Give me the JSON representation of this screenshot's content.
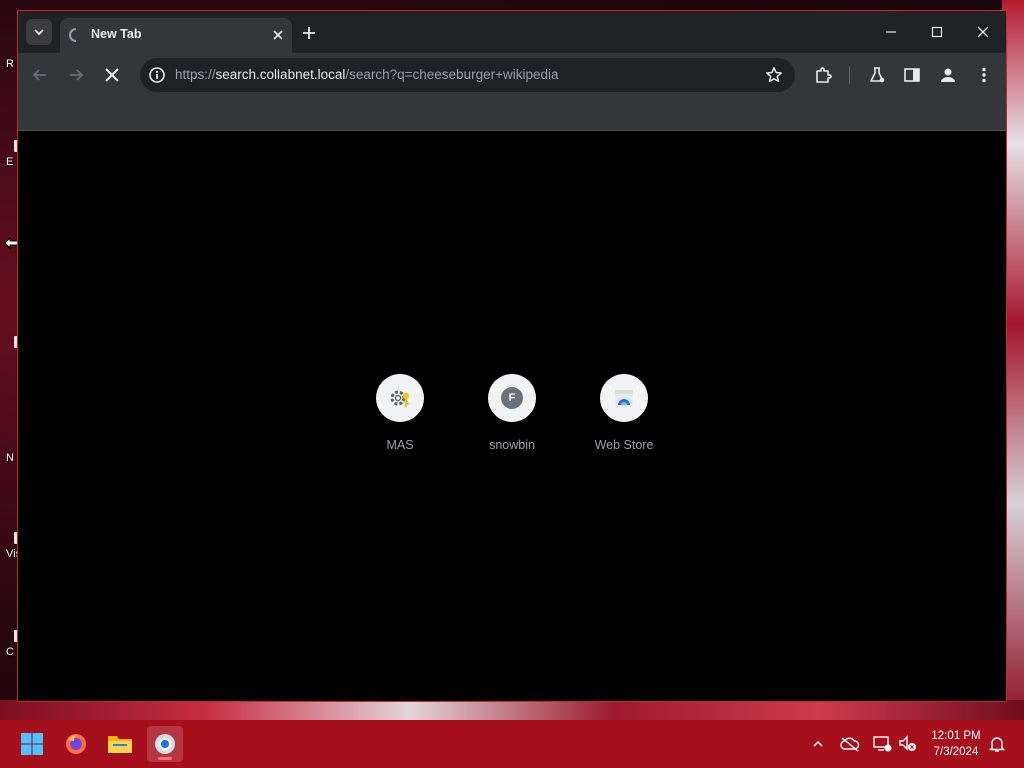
{
  "desktop": {
    "labels": [
      "R",
      "E",
      "N",
      "Vis",
      "C"
    ]
  },
  "browser": {
    "tab": {
      "title": "New Tab"
    },
    "omnibox": {
      "url_scheme": "https://",
      "url_host": "search.collabnet.local",
      "url_path": "/search?q=cheeseburger+wikipedia"
    },
    "shortcuts": [
      {
        "label": "MAS",
        "icon": "gear-key-icon"
      },
      {
        "label": "snowbin",
        "icon": "letter-f-avatar",
        "letter": "F"
      },
      {
        "label": "Web Store",
        "icon": "web-store-icon"
      }
    ],
    "colors": {
      "frame_border": "#c4262e",
      "toolbar": "#35363a",
      "tabstrip": "#202124"
    }
  },
  "taskbar": {
    "apps": [
      {
        "name": "start",
        "icon": "windows-icon"
      },
      {
        "name": "firefox",
        "icon": "firefox-icon"
      },
      {
        "name": "file-explorer",
        "icon": "folder-icon"
      },
      {
        "name": "chrome",
        "icon": "chrome-icon",
        "active": true
      }
    ],
    "clock": {
      "time": "12:01 PM",
      "date": "7/3/2024"
    },
    "color": "#a6101d"
  }
}
